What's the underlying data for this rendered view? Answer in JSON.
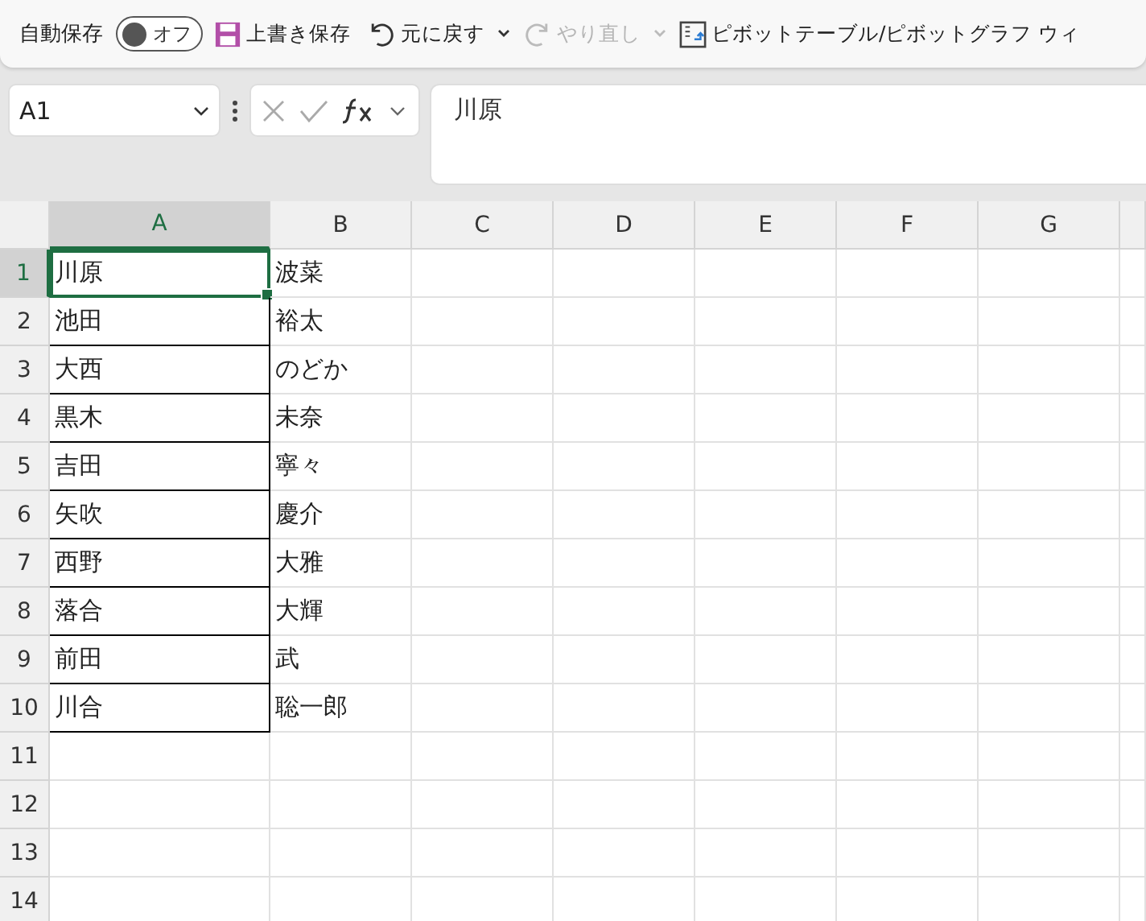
{
  "toolbar": {
    "autosave_label": "自動保存",
    "autosave_toggle": {
      "label": "オフ",
      "on": false
    },
    "save": "上書き保存",
    "undo": "元に戻す",
    "redo": {
      "label": "やり直し",
      "disabled": true
    },
    "pivot": "ピボットテーブル/ピボットグラフ ウィ"
  },
  "formula_bar": {
    "name_box": "A1",
    "formula": "川原"
  },
  "columns": [
    {
      "label": "A",
      "selected": true,
      "bordered": true
    },
    {
      "label": "B",
      "selected": false,
      "bordered": false
    },
    {
      "label": "C",
      "selected": false,
      "bordered": false
    },
    {
      "label": "D",
      "selected": false,
      "bordered": false
    },
    {
      "label": "E",
      "selected": false,
      "bordered": false
    },
    {
      "label": "F",
      "selected": false,
      "bordered": false
    },
    {
      "label": "G",
      "selected": false,
      "bordered": false
    }
  ],
  "rows": [
    {
      "number": "1",
      "selected": true,
      "cells": [
        "川原",
        "波菜"
      ]
    },
    {
      "number": "2",
      "selected": false,
      "cells": [
        "池田",
        "裕太"
      ]
    },
    {
      "number": "3",
      "selected": false,
      "cells": [
        "大西",
        "のどか"
      ]
    },
    {
      "number": "4",
      "selected": false,
      "cells": [
        "黒木",
        "未奈"
      ]
    },
    {
      "number": "5",
      "selected": false,
      "cells": [
        "吉田",
        "寧々"
      ]
    },
    {
      "number": "6",
      "selected": false,
      "cells": [
        "矢吹",
        "慶介"
      ]
    },
    {
      "number": "7",
      "selected": false,
      "cells": [
        "西野",
        "大雅"
      ]
    },
    {
      "number": "8",
      "selected": false,
      "cells": [
        "落合",
        "大輝"
      ]
    },
    {
      "number": "9",
      "selected": false,
      "cells": [
        "前田",
        "武"
      ]
    },
    {
      "number": "10",
      "selected": false,
      "cells": [
        "川合",
        "聡一郎"
      ]
    },
    {
      "number": "11",
      "selected": false
    },
    {
      "number": "12",
      "selected": false
    },
    {
      "number": "13",
      "selected": false
    },
    {
      "number": "14",
      "selected": false
    }
  ]
}
